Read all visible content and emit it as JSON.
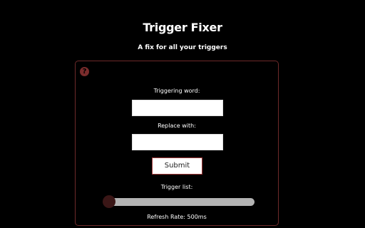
{
  "header": {
    "title": "Trigger Fixer",
    "subtitle": "A fix for all your triggers"
  },
  "panel": {
    "help_icon": "?",
    "triggering_word": {
      "label": "Triggering word:",
      "value": "",
      "placeholder": ""
    },
    "replace_with": {
      "label": "Replace with:",
      "value": "",
      "placeholder": ""
    },
    "submit_label": "Submit",
    "trigger_list_label": "Trigger list:",
    "refresh_rate": {
      "text": "Refresh Rate: 500ms",
      "value_ms": 500,
      "level": 0.02
    }
  },
  "colors": {
    "background": "#000000",
    "panel_border": "#6e2a2a",
    "accent_dark_red": "#3a1616",
    "button_border": "#a33a3a",
    "slider_track": "#b3b3b3"
  },
  "icons": {
    "help": "question-circle-icon"
  }
}
